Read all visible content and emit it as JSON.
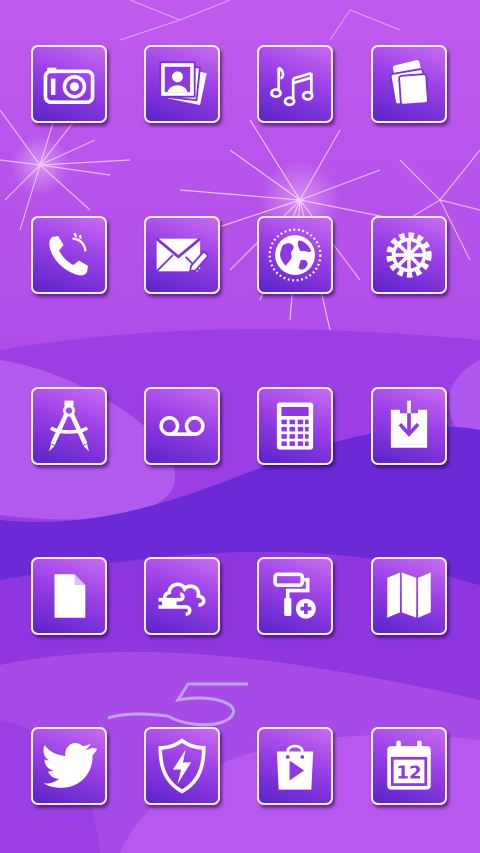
{
  "wallpaper": {
    "sky_color": "#b84fe8",
    "hill_colors": [
      "#c468ef",
      "#8d36e0",
      "#6a2bd6",
      "#a845e5"
    ],
    "firework_color": "#f4d6ff",
    "deco_digit": "5"
  },
  "icons": [
    {
      "name": "camera-icon"
    },
    {
      "name": "gallery-icon"
    },
    {
      "name": "music-icon"
    },
    {
      "name": "themes-icon"
    },
    {
      "name": "phone-icon"
    },
    {
      "name": "messages-icon"
    },
    {
      "name": "browser-icon"
    },
    {
      "name": "settings-icon"
    },
    {
      "name": "tools-compass-icon"
    },
    {
      "name": "voicemail-icon"
    },
    {
      "name": "calculator-icon"
    },
    {
      "name": "downloads-icon"
    },
    {
      "name": "files-icon"
    },
    {
      "name": "weather-icon"
    },
    {
      "name": "paint-roller-add-icon"
    },
    {
      "name": "maps-icon"
    },
    {
      "name": "twitter-icon"
    },
    {
      "name": "security-shield-icon"
    },
    {
      "name": "play-store-icon"
    },
    {
      "name": "calendar-icon"
    }
  ],
  "calendar": {
    "day": "12"
  }
}
